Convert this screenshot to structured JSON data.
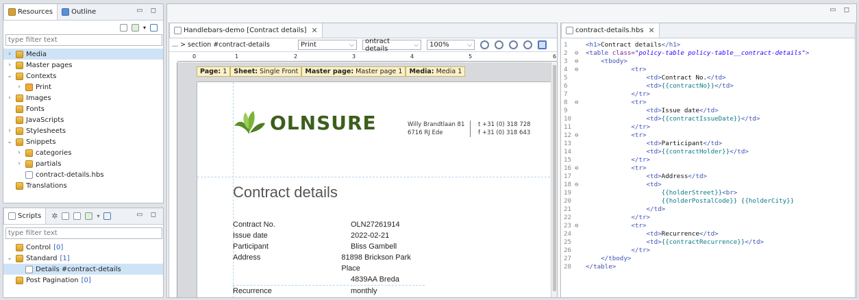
{
  "resources_panel": {
    "tabs": [
      {
        "label": "Resources",
        "icon": "resources-icon"
      },
      {
        "label": "Outline",
        "icon": "outline-icon"
      }
    ],
    "filter_placeholder": "type filter text",
    "tree": [
      {
        "label": "Media",
        "selected": true,
        "twisty": "›"
      },
      {
        "label": "Master pages",
        "twisty": "›"
      },
      {
        "label": "Contexts",
        "twisty": "⌄"
      },
      {
        "label": "Print",
        "twisty": "›"
      },
      {
        "label": "Images",
        "twisty": "›"
      },
      {
        "label": "Fonts",
        "twisty": ""
      },
      {
        "label": "JavaScripts",
        "twisty": ""
      },
      {
        "label": "Stylesheets",
        "twisty": "›"
      },
      {
        "label": "Snippets",
        "twisty": "⌄"
      },
      {
        "label": "categories",
        "twisty": "›"
      },
      {
        "label": "partials",
        "twisty": "›"
      },
      {
        "label": "contract-details.hbs",
        "twisty": ""
      },
      {
        "label": "Translations",
        "twisty": ""
      }
    ]
  },
  "scripts_panel": {
    "tab": "Scripts",
    "filter_placeholder": "type filter text",
    "tree": [
      {
        "label": "Control",
        "count": "[0]",
        "twisty": ""
      },
      {
        "label": "Standard",
        "count": "[1]",
        "twisty": "⌄"
      },
      {
        "label": "Details #contract-details",
        "count": "",
        "twisty": "",
        "selected": true
      },
      {
        "label": "Post Pagination",
        "count": "[0]",
        "twisty": ""
      }
    ]
  },
  "editor": {
    "tab_label": "Handlebars-demo [Contract details]",
    "breadcrumb": "... > section #contract-details",
    "context_select": "Print",
    "section_select": "ontract details",
    "zoom_select": "100%",
    "ruler_numbers": [
      "0",
      "1",
      "2",
      "3",
      "4",
      "5",
      "6"
    ],
    "page_info": {
      "page_label": "Page:",
      "page_value": "1",
      "sheet_label": "Sheet:",
      "sheet_value": "Single Front",
      "master_label": "Master page:",
      "master_value": "Master page 1",
      "media_label": "Media:",
      "media_value": "Media 1"
    },
    "letterhead": {
      "logo_text": "OLNSURE",
      "address_line1": "Willy Brandtlaan 81",
      "address_line2": "6716 RJ Ede",
      "phone_t": "t  +31 (0) 318 728",
      "phone_f": "f  +31 (0) 318 643"
    },
    "document": {
      "heading": "Contract details",
      "rows": [
        {
          "label": "Contract No.",
          "value": "OLN27261914"
        },
        {
          "label": "Issue date",
          "value": "2022-02-21"
        },
        {
          "label": "Participant",
          "value": "Bliss Gambell"
        },
        {
          "label": "Address",
          "value": "81898 Brickson Park Place"
        },
        {
          "label": "",
          "value": "4839AA Breda"
        },
        {
          "label": "Recurrence",
          "value": "monthly"
        }
      ]
    }
  },
  "code_editor": {
    "tab_label": "contract-details.hbs",
    "line_numbers": [
      "1",
      "2",
      "3",
      "4",
      "5",
      "6",
      "7",
      "8",
      "9",
      "10",
      "11",
      "12",
      "13",
      "14",
      "15",
      "16",
      "17",
      "18",
      "19",
      "20",
      "21",
      "22",
      "23",
      "24",
      "25",
      "26",
      "27",
      "28"
    ],
    "folds": [
      "",
      "⊖",
      "⊖",
      "⊖",
      "",
      "",
      "",
      "⊖",
      "",
      "",
      "",
      "⊖",
      "",
      "",
      "",
      "⊖",
      "",
      "⊖",
      "",
      "",
      "",
      "",
      "⊖",
      "",
      "",
      "",
      "",
      ""
    ]
  }
}
